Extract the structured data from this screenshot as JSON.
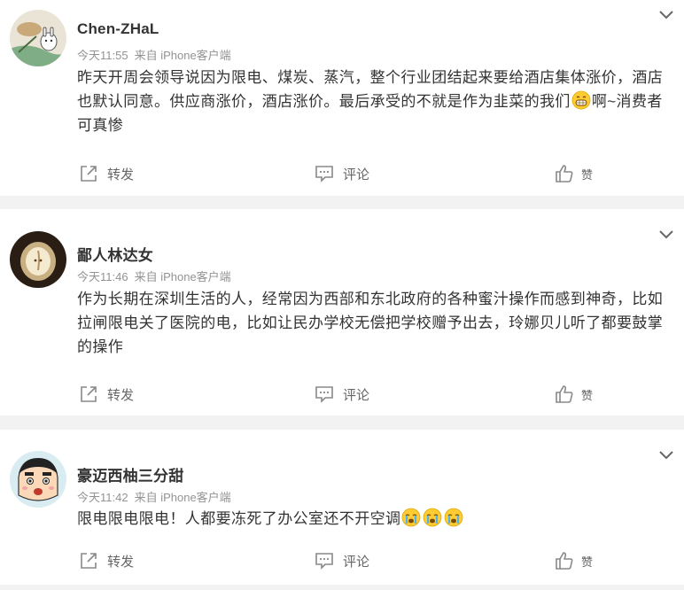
{
  "posts": [
    {
      "name": "Chen-ZHaL",
      "time": "今天11:55",
      "source": "来自 iPhone客户端",
      "text_before": "昨天开周会领导说因为限电、煤炭、蒸汽，整个行业团结起来要给酒店集体涨价，酒店也默认同意。供应商涨价，酒店涨价。最后承受的不就是作为韭菜的我们",
      "emoji": "grin-emoji",
      "text_after": "啊~消费者可真惨",
      "avatar": "cartoon-cat-avatar"
    },
    {
      "name": "鄙人林达女",
      "time": "今天11:46",
      "source": "来自 iPhone客户端",
      "text": "作为长期在深圳生活的人，经常因为西部和东北政府的各种蜜汁操作而感到神奇，比如拉闸限电关了医院的电，比如让民办学校无偿把学校赠予出去，玲娜贝儿听了都要鼓掌的操作",
      "avatar": "apple-photo-avatar"
    },
    {
      "name": "豪迈西柚三分甜",
      "time": "今天11:42",
      "source": "来自 iPhone客户端",
      "text": "限电限电限电！人都要冻死了办公室还不开空调",
      "emojis": [
        "crying-emoji",
        "crying-emoji",
        "crying-emoji"
      ],
      "avatar": "crayon-shinchan-avatar"
    }
  ],
  "actions": {
    "repost": "转发",
    "comment": "评论",
    "like": "赞"
  },
  "icons": {
    "more": "chevron-down-icon",
    "repost": "share-icon",
    "comment": "comment-icon",
    "like": "thumbs-up-icon"
  },
  "colors": {
    "page_background": "#f2f2f2",
    "card_background": "#ffffff",
    "text": "#333333",
    "meta": "#939393",
    "icon": "#888888"
  }
}
